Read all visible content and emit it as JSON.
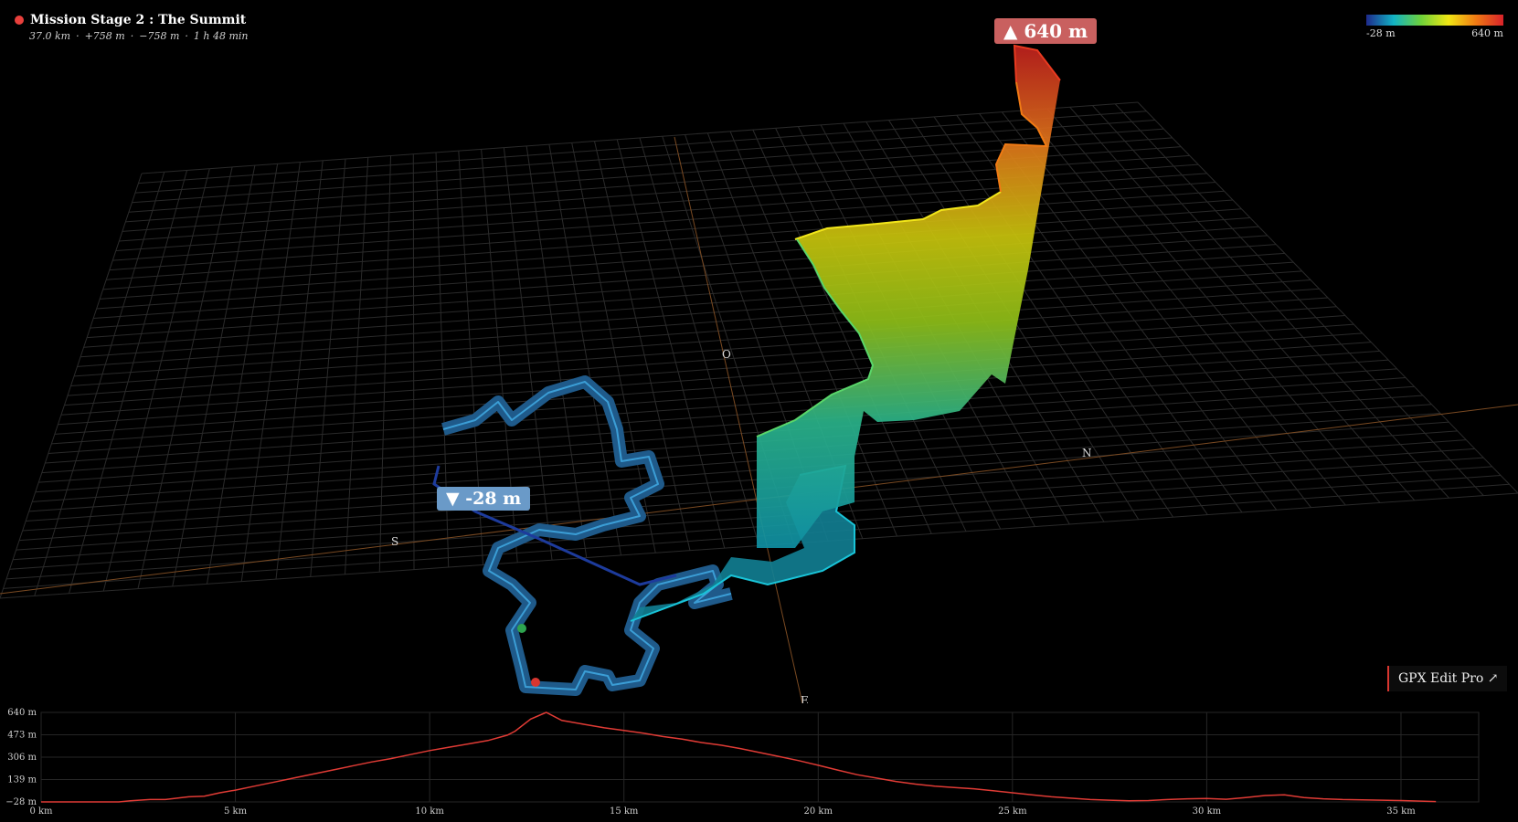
{
  "route": {
    "title": "Mission Stage 2 : The Summit",
    "distance": "37.0 km",
    "ascent": "+758 m",
    "descent": "−758 m",
    "duration": "1 h 48 min",
    "stat_separator": "·"
  },
  "legend": {
    "min_label": "-28 m",
    "max_label": "640 m",
    "gradient": [
      "#1e2a8c",
      "#12b3c4",
      "#6fd23a",
      "#f0e614",
      "#f07a14",
      "#d8222a"
    ]
  },
  "badges": {
    "max": "▲ 640 m",
    "min": "▼ -28 m"
  },
  "compass": {
    "s": "S",
    "n": "N",
    "o": "O",
    "e": "E"
  },
  "gpx_link": "GPX Edit Pro ↗",
  "colors": {
    "profile_line": "#e03b35",
    "grid": "#2a2a2a",
    "axis": "#7a4a22"
  },
  "chart_data": {
    "type": "line",
    "ylabel": "",
    "xlabel": "",
    "ylim": [
      -28,
      640
    ],
    "xlim": [
      0,
      37
    ],
    "y_ticks": [
      640,
      473,
      306,
      139,
      -28
    ],
    "y_tick_labels": [
      "640 m",
      "473 m",
      "306 m",
      "139 m",
      "−28 m"
    ],
    "x_ticks": [
      0,
      5,
      10,
      15,
      20,
      25,
      30,
      35
    ],
    "x_tick_labels": [
      "0 km",
      "5 km",
      "10 km",
      "15 km",
      "20 km",
      "25 km",
      "30 km",
      "35 km"
    ],
    "x": [
      0,
      1,
      2,
      2.3,
      2.8,
      3.2,
      3.8,
      4.2,
      4.6,
      5,
      5.5,
      6,
      6.5,
      7,
      7.5,
      8,
      8.5,
      9,
      9.5,
      10,
      10.5,
      11,
      11.5,
      12,
      12.2,
      12.6,
      13,
      13.4,
      14,
      14.5,
      15,
      15.5,
      16,
      16.5,
      17,
      17.5,
      18,
      18.5,
      19,
      19.5,
      20,
      20.5,
      21,
      21.5,
      22,
      22.5,
      23,
      23.5,
      24,
      24.5,
      25,
      25.5,
      26,
      26.5,
      27,
      27.5,
      28,
      28.5,
      29,
      29.5,
      30,
      30.5,
      31,
      31.5,
      32,
      32.5,
      33,
      33.5,
      34,
      34.5,
      35,
      35.5,
      35.9
    ],
    "y": [
      -28,
      -28,
      -28,
      -20,
      -10,
      -10,
      10,
      15,
      40,
      60,
      90,
      120,
      150,
      180,
      210,
      240,
      270,
      295,
      325,
      355,
      380,
      405,
      430,
      470,
      500,
      590,
      640,
      580,
      550,
      525,
      505,
      485,
      460,
      440,
      415,
      395,
      370,
      340,
      310,
      280,
      245,
      210,
      175,
      150,
      125,
      105,
      90,
      80,
      70,
      55,
      40,
      25,
      10,
      0,
      -10,
      -15,
      -20,
      -18,
      -10,
      -5,
      -2,
      -8,
      5,
      20,
      25,
      5,
      -5,
      -10,
      -12,
      -15,
      -18,
      -22,
      -25
    ]
  }
}
